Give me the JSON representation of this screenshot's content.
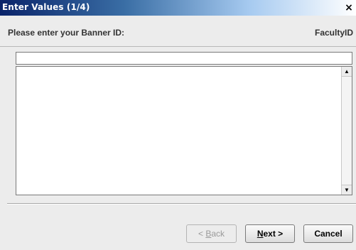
{
  "window": {
    "title": "Enter Values (1/4)",
    "close_glyph": "×"
  },
  "prompt": {
    "label": "Please enter your Banner ID:",
    "field_name": "FacultyID"
  },
  "input": {
    "value": ""
  },
  "list": {
    "items": []
  },
  "scrollbar": {
    "up_glyph": "▲",
    "down_glyph": "▼"
  },
  "buttons": {
    "back": {
      "prefix": "< ",
      "mnemonic": "B",
      "rest": "ack",
      "enabled": false
    },
    "next": {
      "mnemonic": "N",
      "rest": "ext >",
      "enabled": true
    },
    "cancel": {
      "label": "Cancel",
      "enabled": true
    }
  },
  "colors": {
    "title_gradient_start": "#0a246a",
    "window_background": "#ececec"
  }
}
